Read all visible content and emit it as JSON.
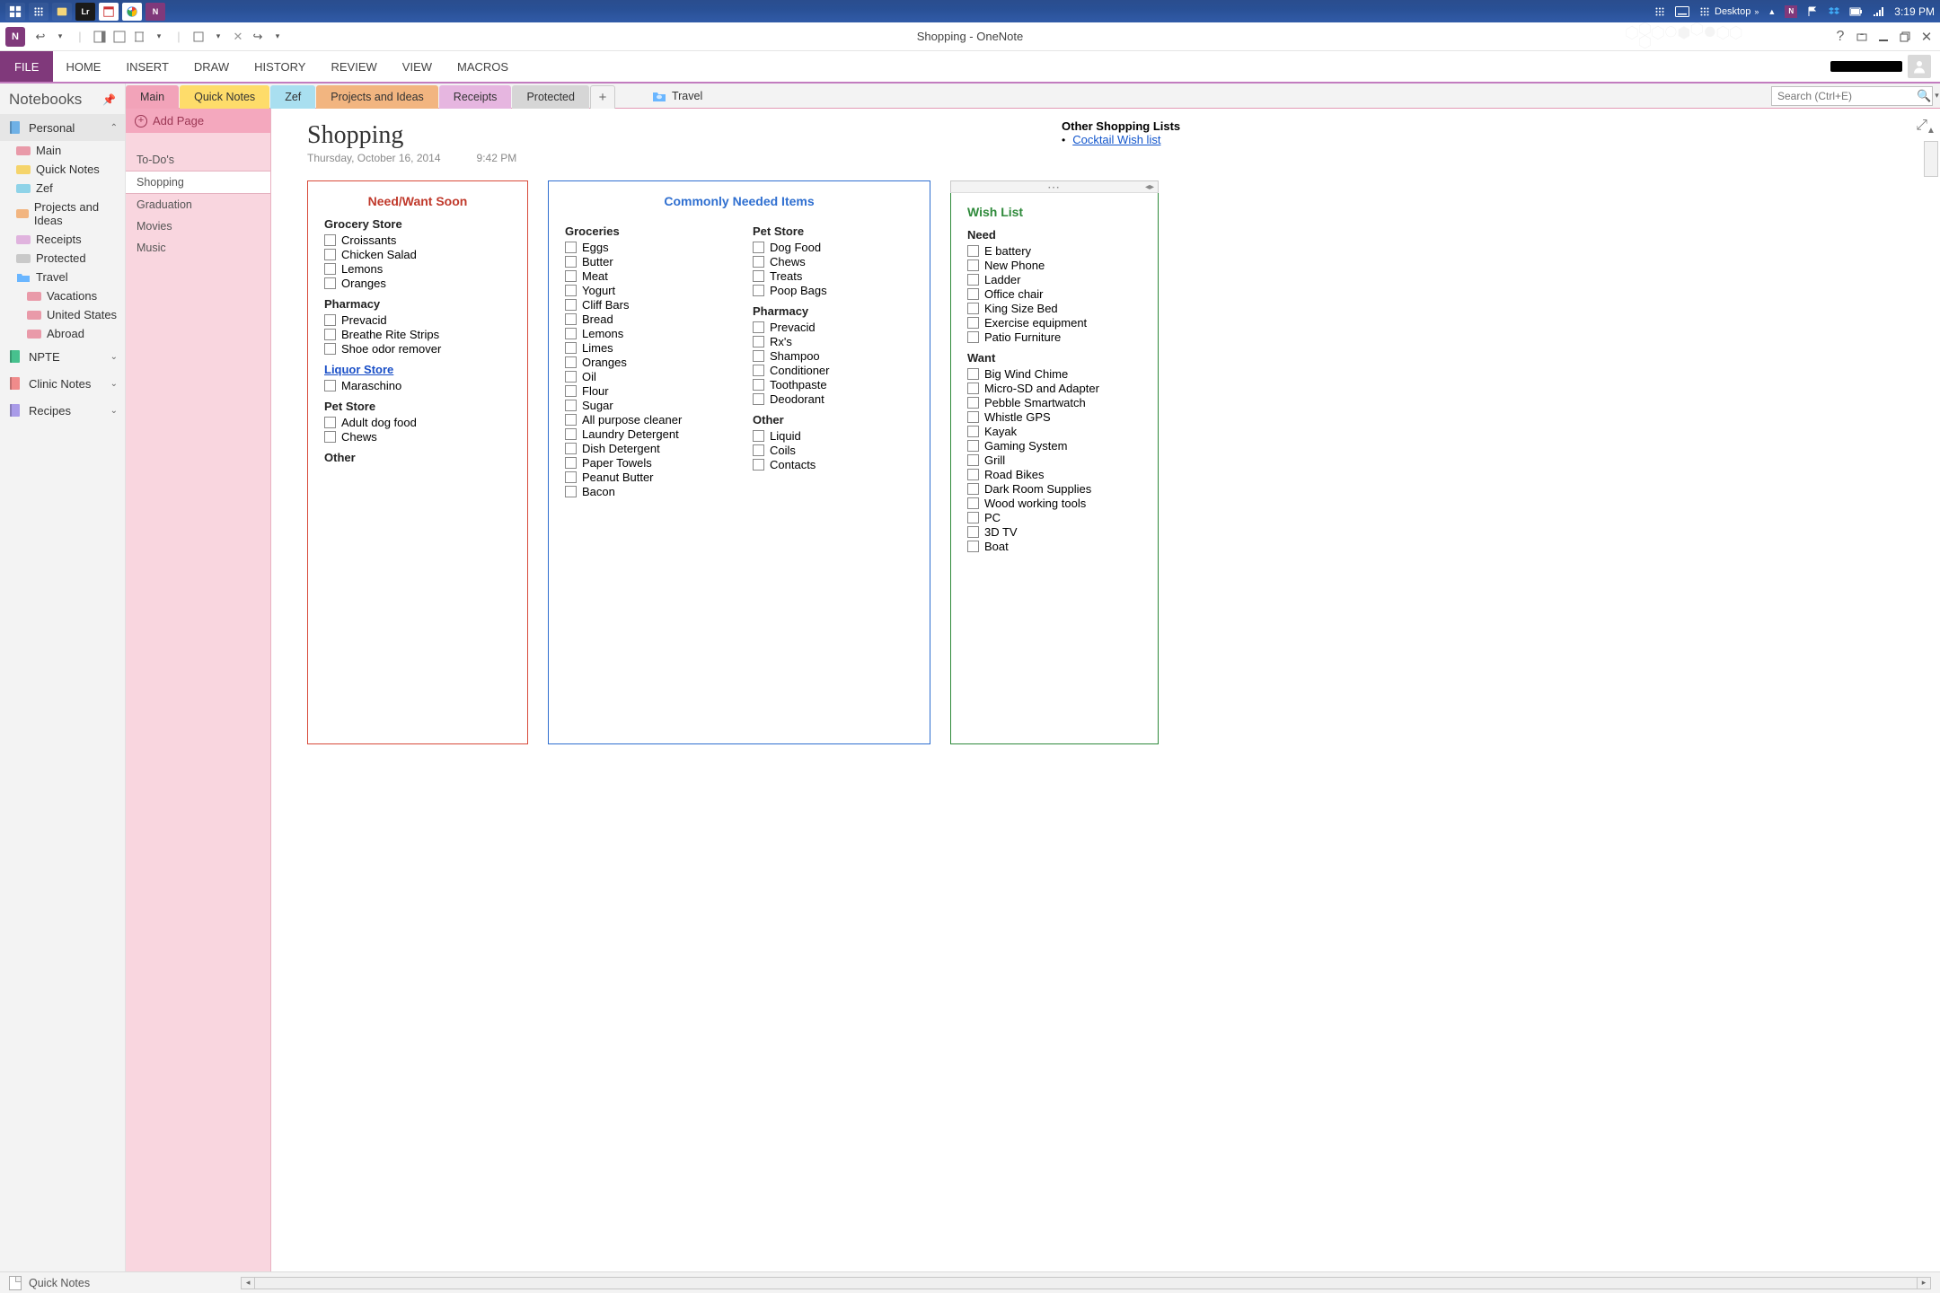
{
  "taskbar": {
    "desktop_label": "Desktop",
    "clock": "3:19 PM"
  },
  "window": {
    "title": "Shopping - OneNote",
    "ribbon": {
      "file": "FILE",
      "tabs": [
        "HOME",
        "INSERT",
        "DRAW",
        "HISTORY",
        "REVIEW",
        "VIEW",
        "MACROS"
      ]
    },
    "search_placeholder": "Search (Ctrl+E)"
  },
  "notebooks": {
    "header": "Notebooks",
    "books": [
      {
        "name": "Personal",
        "color": "#6fb1e6",
        "expanded": true,
        "sections": [
          {
            "name": "Main",
            "color": "#e99aa9"
          },
          {
            "name": "Quick Notes",
            "color": "#f5d46b"
          },
          {
            "name": "Zef",
            "color": "#8fd3e8"
          },
          {
            "name": "Projects and Ideas",
            "color": "#f2b580"
          },
          {
            "name": "Receipts",
            "color": "#e0b3de"
          },
          {
            "name": "Protected",
            "color": "#c9c9c9"
          },
          {
            "name": "Travel",
            "color": "#6ab6ff",
            "is_group": true,
            "children": [
              {
                "name": "Vacations",
                "color": "#e99aa9"
              },
              {
                "name": "United States",
                "color": "#e99aa9"
              },
              {
                "name": "Abroad",
                "color": "#e99aa9"
              }
            ]
          }
        ]
      },
      {
        "name": "NPTE",
        "color": "#47c18e"
      },
      {
        "name": "Clinic Notes",
        "color": "#f08b8b"
      },
      {
        "name": "Recipes",
        "color": "#a99be8"
      }
    ]
  },
  "section_tabs": {
    "tabs": [
      {
        "label": "Main",
        "cls": "main"
      },
      {
        "label": "Quick Notes",
        "cls": "qn"
      },
      {
        "label": "Zef",
        "cls": "zef"
      },
      {
        "label": "Projects and Ideas",
        "cls": "proj"
      },
      {
        "label": "Receipts",
        "cls": "rec"
      },
      {
        "label": "Protected",
        "cls": "prot"
      }
    ],
    "travel_link": "Travel"
  },
  "pages_panel": {
    "add_page": "Add Page",
    "pages": [
      "To-Do's",
      "Shopping",
      "Graduation",
      "Movies",
      "Music"
    ],
    "selected": 1
  },
  "page": {
    "title": "Shopping",
    "date": "Thursday, October 16, 2014",
    "time": "9:42 PM",
    "other_title": "Other Shopping Lists",
    "other_link": "Cocktail Wish list"
  },
  "box_red": {
    "title": "Need/Want Soon",
    "groups": [
      {
        "title": "Grocery Store",
        "items": [
          "Croissants",
          "Chicken Salad",
          "Lemons",
          "Oranges"
        ]
      },
      {
        "title": "Pharmacy",
        "items": [
          "Prevacid",
          "Breathe Rite Strips",
          "Shoe odor remover"
        ]
      },
      {
        "title": "Liquor Store",
        "is_link": true,
        "items": [
          "Maraschino"
        ]
      },
      {
        "title": "Pet Store",
        "items": [
          "Adult dog food",
          "Chews"
        ]
      },
      {
        "title": "Other",
        "items": []
      }
    ]
  },
  "box_blue": {
    "title": "Commonly Needed Items",
    "col1": [
      {
        "title": "Groceries",
        "items": [
          "Eggs",
          "Butter",
          "Meat",
          "Yogurt",
          "Cliff Bars",
          "Bread",
          "Lemons",
          "Limes",
          "Oranges",
          "Oil",
          "Flour",
          "Sugar",
          "All purpose cleaner",
          "Laundry Detergent",
          "Dish Detergent",
          "Paper Towels",
          "Peanut Butter",
          "Bacon"
        ]
      }
    ],
    "col2": [
      {
        "title": "Pet Store",
        "items": [
          "Dog Food",
          "Chews",
          "Treats",
          "Poop Bags"
        ]
      },
      {
        "title": "Pharmacy",
        "items": [
          "Prevacid",
          "Rx's",
          "Shampoo",
          "Conditioner",
          "Toothpaste",
          "Deodorant"
        ]
      },
      {
        "title": "Other",
        "items": [
          "Liquid",
          "Coils",
          "Contacts"
        ]
      }
    ]
  },
  "box_green": {
    "title": "Wish List",
    "groups": [
      {
        "title": "Need",
        "items": [
          "E battery",
          "New Phone",
          "Ladder",
          "Office chair",
          "King Size Bed",
          "Exercise equipment",
          "Patio Furniture"
        ]
      },
      {
        "title": "Want",
        "items": [
          "Big Wind Chime",
          "Micro-SD and Adapter",
          "Pebble Smartwatch",
          "Whistle GPS",
          "Kayak",
          "Gaming System",
          "Grill",
          "Road Bikes",
          "Dark Room Supplies",
          "Wood working tools",
          "PC",
          "3D TV",
          "Boat"
        ]
      }
    ]
  },
  "statusbar": {
    "quick_notes": "Quick Notes"
  }
}
